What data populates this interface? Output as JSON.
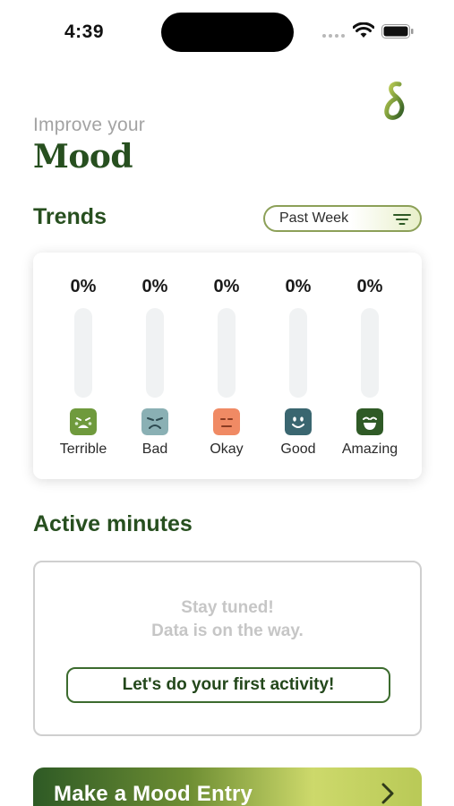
{
  "status_bar": {
    "time": "4:39"
  },
  "header": {
    "subtitle": "Improve your",
    "title": "Mood"
  },
  "trends": {
    "title": "Trends",
    "filter_label": "Past Week",
    "moods": [
      {
        "label": "Terrible",
        "percent": "0%",
        "value": 0,
        "color": "#6f9a3d",
        "icon": "crying-face-icon"
      },
      {
        "label": "Bad",
        "percent": "0%",
        "value": 0,
        "color": "#8ab0b4",
        "icon": "sad-face-icon"
      },
      {
        "label": "Okay",
        "percent": "0%",
        "value": 0,
        "color": "#f08a64",
        "icon": "neutral-face-icon"
      },
      {
        "label": "Good",
        "percent": "0%",
        "value": 0,
        "color": "#3a6670",
        "icon": "smile-face-icon"
      },
      {
        "label": "Amazing",
        "percent": "0%",
        "value": 0,
        "color": "#2f5a26",
        "icon": "laughing-face-icon"
      }
    ]
  },
  "active_minutes": {
    "title": "Active minutes",
    "empty_line1": "Stay tuned!",
    "empty_line2": "Data is on the way.",
    "button_label": "Let's do your first activity!"
  },
  "mood_entry": {
    "label": "Make a Mood Entry"
  },
  "colors": {
    "brand_green": "#274f1f",
    "accent_lime": "#cdd96b"
  }
}
